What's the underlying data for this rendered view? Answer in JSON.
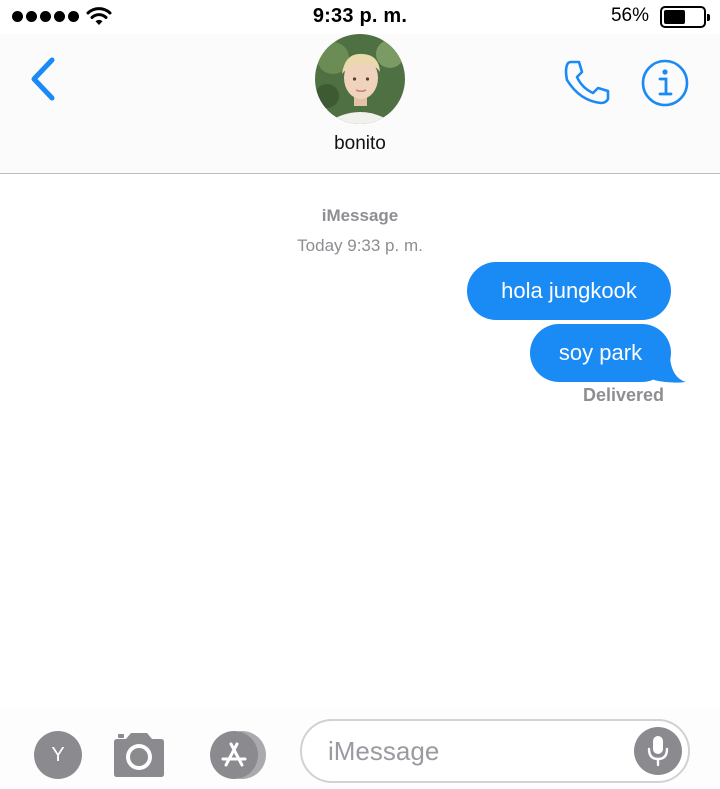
{
  "status_bar": {
    "time": "9:33 p. m.",
    "battery_percent": "56%",
    "battery_level": 0.56,
    "signal_bars": 5,
    "icons": [
      "signal-dots-icon",
      "wifi-icon",
      "battery-icon"
    ]
  },
  "header": {
    "contact_name": "bonito",
    "back_icon": "chevron-left-icon",
    "call_icon": "phone-icon",
    "info_icon": "info-icon"
  },
  "conversation": {
    "service": "iMessage",
    "timestamp": "Today 9:33 p. m.",
    "messages": [
      {
        "text": "hola jungkook",
        "from": "me"
      },
      {
        "text": "soy park",
        "from": "me"
      }
    ],
    "status": "Delivered"
  },
  "input_bar": {
    "app_letter": "Y",
    "placeholder": "iMessage",
    "value": "",
    "icons": [
      "camera-icon",
      "app-store-icon",
      "microphone-icon"
    ]
  },
  "colors": {
    "accent": "#1a8bf4",
    "bubble_text": "#ffffff",
    "secondary_text": "#8e8e93",
    "icon_gray": "#8a8a8f"
  }
}
